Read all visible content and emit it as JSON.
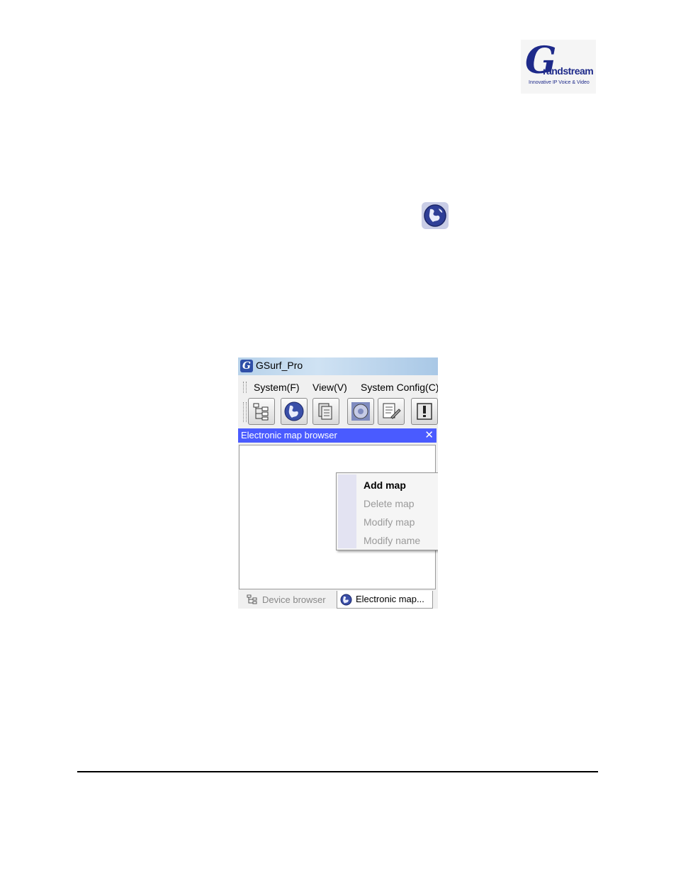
{
  "logo": {
    "mark": "G",
    "word": "randstream",
    "tagline": "Innovative IP Voice & Video"
  },
  "window": {
    "title": "GSurf_Pro",
    "menus": [
      {
        "label": "System(F)"
      },
      {
        "label": "View(V)"
      },
      {
        "label": "System Config(C)"
      }
    ],
    "toolbar_icons": [
      "device-tree-icon",
      "globe-icon",
      "playback-icon",
      "ptz-icon",
      "log-icon",
      "alarm-icon"
    ]
  },
  "panel": {
    "title": "Electronic map browser",
    "close_glyph": "✕"
  },
  "context_menu": {
    "items": [
      {
        "label": "Add map",
        "enabled": true
      },
      {
        "label": "Delete map",
        "enabled": false
      },
      {
        "label": "Modify map",
        "enabled": false
      },
      {
        "label": "Modify name",
        "enabled": false
      }
    ]
  },
  "tabs": [
    {
      "label": "Device browser",
      "active": false
    },
    {
      "label": "Electronic map...",
      "active": true
    }
  ],
  "colors": {
    "panel_header": "#4a5bff",
    "logo_blue": "#1e2a8a",
    "globe_blue": "#3a4fa8"
  }
}
